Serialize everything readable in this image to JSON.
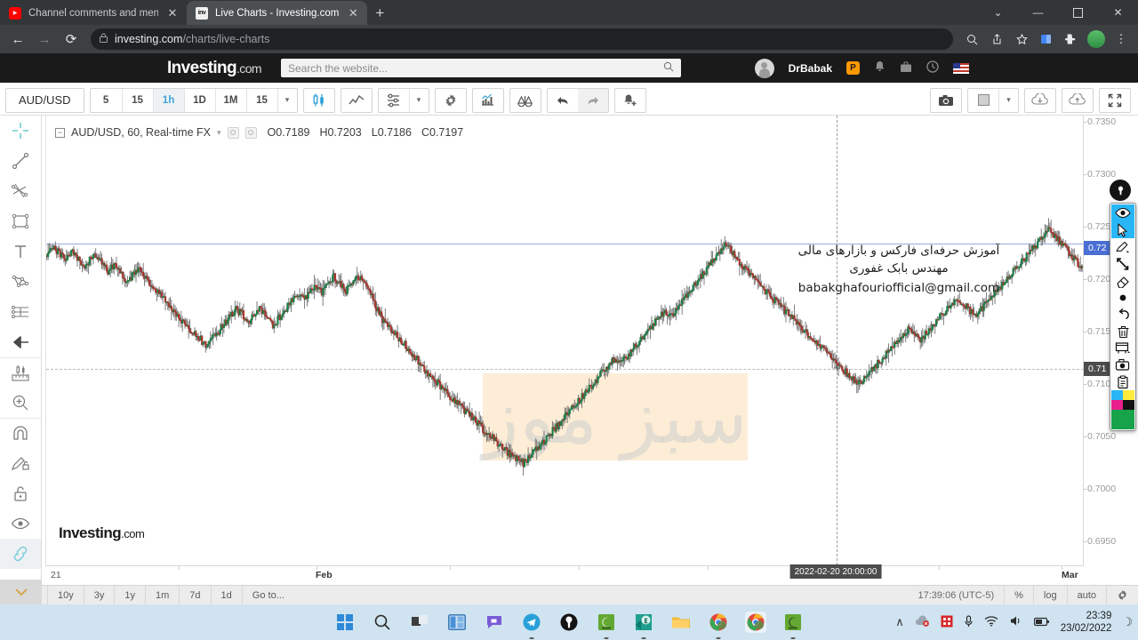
{
  "browser": {
    "tabs": [
      {
        "title": "Channel comments and mention",
        "favicon": "youtube-icon",
        "active": false
      },
      {
        "title": "Live Charts - Investing.com",
        "favicon": "investing-icon",
        "active": true
      }
    ],
    "new_tab_label": "+",
    "window_controls": {
      "chevron": "⌄",
      "minimize": "—",
      "maximize": "❐",
      "close": "✕"
    },
    "nav": {
      "back": "←",
      "forward": "→",
      "reload": "⟳"
    },
    "omnibox": {
      "lock": "🔒",
      "url_domain": "investing.com",
      "url_path": "/charts/live-charts"
    },
    "omni_icons": [
      "zoom-icon",
      "share-icon",
      "bookmark-star-icon",
      "split-screen-icon",
      "extensions-icon",
      "profile-avatar",
      "menu-kebab-icon"
    ]
  },
  "site_header": {
    "logo_main": "Investing",
    "logo_suffix": ".com",
    "search_placeholder": "Search the website...",
    "search_value": "",
    "user_name": "DrBabak",
    "pro_badge": "P",
    "icons": [
      "bell-icon",
      "portfolio-icon",
      "clock-icon",
      "flag-us-icon"
    ]
  },
  "chart_toolbar": {
    "symbol": "AUD/USD",
    "timeframes": [
      {
        "label": "5",
        "active": false
      },
      {
        "label": "15",
        "active": false
      },
      {
        "label": "1h",
        "active": true
      },
      {
        "label": "1D",
        "active": false
      },
      {
        "label": "1M",
        "active": false
      },
      {
        "label": "15",
        "active": false
      }
    ],
    "dropdown_caret": "▾",
    "buttons": [
      {
        "name": "candlestick-chart-type-icon",
        "selected": true
      },
      {
        "name": "line-chart-type-icon",
        "selected": false
      },
      {
        "name": "indicators-icon",
        "selected": false
      },
      {
        "name": "indicators-caret-icon",
        "selected": false
      },
      {
        "name": "settings-gear-icon",
        "selected": false
      },
      {
        "name": "compare-icon",
        "selected": false
      },
      {
        "name": "balance-scale-icon",
        "selected": false
      },
      {
        "name": "undo-icon",
        "selected": false
      },
      {
        "name": "redo-icon",
        "selected": false
      },
      {
        "name": "alert-bell-icon",
        "selected": false
      }
    ],
    "right_buttons": [
      {
        "name": "camera-snapshot-icon"
      },
      {
        "name": "layout-swatch-icon"
      },
      {
        "name": "layout-caret-icon"
      },
      {
        "name": "cloud-download-icon"
      },
      {
        "name": "cloud-upload-icon"
      },
      {
        "name": "fullscreen-icon"
      }
    ]
  },
  "left_tools": [
    {
      "name": "crosshair-tool"
    },
    {
      "name": "trend-line-tool"
    },
    {
      "name": "fib-tools"
    },
    {
      "name": "rectangle-tool"
    },
    {
      "name": "text-tool"
    },
    {
      "name": "pattern-tool"
    },
    {
      "name": "pitchfork-tool"
    },
    {
      "name": "arrow-tool"
    },
    {
      "name": "measure-tool"
    },
    {
      "name": "zoom-in-tool"
    },
    {
      "name": "magnet-tool"
    },
    {
      "name": "drawing-lock-tool"
    },
    {
      "name": "lock-tool"
    },
    {
      "name": "hide-drawings-tool"
    },
    {
      "name": "link-tool",
      "active": true
    }
  ],
  "chart_info": {
    "collapse": "−",
    "symbol_line": "AUD/USD, 60, Real-time FX",
    "caret": "▾",
    "open": "O0.7189",
    "high": "H0.7203",
    "low": "L0.7186",
    "close": "C0.7197"
  },
  "watermark": {
    "fa_line1": "آموزش حرفه‌ای فارکس و بازارهای مالی",
    "fa_line2": "مهندس بابک غفوری",
    "email": "babakghafouriofficial@gmail.com",
    "big_text": "سبز موز",
    "investing_main": "Investing",
    "investing_suffix": ".com"
  },
  "chart_data": {
    "type": "candlestick",
    "title": "AUD/USD, 60, Real-time FX",
    "symbol": "AUD/USD",
    "interval": "60",
    "source": "Real-time FX",
    "xlabel": "",
    "ylabel": "",
    "grid": true,
    "legend": "none",
    "ylim": [
      0.693,
      0.737
    ],
    "y_ticks": [
      "0.7350",
      "0.7300",
      "0.7250",
      "0.7200",
      "0.7150",
      "0.7100",
      "0.7050",
      "0.7000",
      "0.6950"
    ],
    "y_tick_values": [
      0.735,
      0.73,
      0.725,
      0.72,
      0.715,
      0.71,
      0.705,
      0.7,
      0.695
    ],
    "x_ticks": [
      "21",
      "Feb",
      "Mar"
    ],
    "price_labels": [
      {
        "value": "0.72",
        "kind": "current-bid",
        "color": "#4a6fd4",
        "y_value": 0.7219
      },
      {
        "value": "0.71",
        "kind": "crosshair",
        "color": "#4c4c4c",
        "y_value": 0.7142
      }
    ],
    "crosshair": {
      "x_label": "2022-02-20 20:00:00",
      "y_label": "0.71"
    },
    "colors": {
      "up": "#1a8046",
      "down": "#a8352d",
      "level_line": "#9aa8e0"
    },
    "ohlc_readout": {
      "open": 0.7189,
      "high": 0.7203,
      "low": 0.7186,
      "close": 0.7197
    },
    "series": [
      {
        "name": "AUD/USD 1h candles",
        "note": "close-price path sampled across the visible window (~0-1168px plot width)",
        "closes": [
          0.7233,
          0.724,
          0.7236,
          0.7228,
          0.7237,
          0.7231,
          0.7222,
          0.7228,
          0.7234,
          0.7225,
          0.7218,
          0.7224,
          0.7216,
          0.7209,
          0.7213,
          0.722,
          0.7214,
          0.7206,
          0.7198,
          0.7191,
          0.7185,
          0.7178,
          0.717,
          0.7163,
          0.7157,
          0.7152,
          0.7146,
          0.715,
          0.7158,
          0.7166,
          0.7173,
          0.718,
          0.7176,
          0.7169,
          0.7174,
          0.7181,
          0.7172,
          0.7165,
          0.7172,
          0.718,
          0.7188,
          0.7195,
          0.7189,
          0.7196,
          0.7203,
          0.7198,
          0.7206,
          0.7212,
          0.7205,
          0.7199,
          0.7206,
          0.7213,
          0.7208,
          0.7196,
          0.7182,
          0.717,
          0.7162,
          0.7156,
          0.715,
          0.7143,
          0.7136,
          0.7128,
          0.7121,
          0.7115,
          0.7108,
          0.7102,
          0.7096,
          0.709,
          0.7084,
          0.7078,
          0.7072,
          0.7066,
          0.706,
          0.7055,
          0.7049,
          0.7043,
          0.7038,
          0.7034,
          0.703,
          0.7036,
          0.7042,
          0.7049,
          0.7056,
          0.7063,
          0.707,
          0.7077,
          0.7084,
          0.7091,
          0.7098,
          0.7105,
          0.7112,
          0.7119,
          0.7126,
          0.7133,
          0.7128,
          0.7135,
          0.7142,
          0.715,
          0.7157,
          0.7164,
          0.7171,
          0.7178,
          0.7172,
          0.718,
          0.7188,
          0.7196,
          0.7204,
          0.7212,
          0.722,
          0.7228,
          0.7236,
          0.7244,
          0.7238,
          0.723,
          0.7222,
          0.7215,
          0.7208,
          0.7202,
          0.7196,
          0.719,
          0.7184,
          0.7178,
          0.7172,
          0.7166,
          0.716,
          0.7154,
          0.7148,
          0.7142,
          0.7136,
          0.713,
          0.7124,
          0.7118,
          0.7113,
          0.7108,
          0.7114,
          0.712,
          0.7127,
          0.7134,
          0.7141,
          0.7148,
          0.7155,
          0.7162,
          0.7156,
          0.715,
          0.7157,
          0.7164,
          0.7171,
          0.7178,
          0.7185,
          0.7192,
          0.7186,
          0.718,
          0.7174,
          0.7181,
          0.7188,
          0.7195,
          0.7202,
          0.7209,
          0.7216,
          0.7223,
          0.723,
          0.7237,
          0.7244,
          0.7251,
          0.7258,
          0.7252,
          0.7245,
          0.7238,
          0.7231,
          0.7224,
          0.7219
        ]
      }
    ]
  },
  "time_axis": {
    "labels": [
      {
        "text": "21",
        "x": 6,
        "bold": false
      },
      {
        "text": "Feb",
        "x": 304,
        "bold": true
      },
      {
        "text": "Mar",
        "x": 1143,
        "bold": true
      }
    ],
    "crosshair_badge": "2022-02-20 20:00:00"
  },
  "chart_footer": {
    "ranges": [
      "10y",
      "3y",
      "1y",
      "1m",
      "7d",
      "1d"
    ],
    "goto_label": "Go to...",
    "time": "17:39:06 (UTC-5)",
    "scale_percent": "%",
    "scale_log": "log",
    "scale_auto": "auto",
    "settings_icon": "gear-icon"
  },
  "annotation_toolbar": {
    "pen_orb": "pen-orb-icon",
    "items": [
      {
        "name": "eye-visibility-icon",
        "selected": true
      },
      {
        "name": "cursor-select-icon",
        "selected": true
      },
      {
        "name": "pen-highlighter-icon",
        "selected": false
      },
      {
        "name": "arrow-draw-icon",
        "selected": false
      },
      {
        "name": "eraser-icon",
        "selected": false
      },
      {
        "name": "dot-size-icon",
        "selected": false
      },
      {
        "name": "undo-arrow-icon",
        "selected": false
      },
      {
        "name": "trash-delete-icon",
        "selected": false
      },
      {
        "name": "whiteboard-icon",
        "selected": false
      },
      {
        "name": "screenshot-camera-icon",
        "selected": false
      },
      {
        "name": "clipboard-icon",
        "selected": false
      }
    ],
    "swatches": [
      "#29b6f6",
      "#ffeb3b",
      "#e91e8c",
      "#111111",
      "#16a34a"
    ]
  },
  "taskbar": {
    "items": [
      {
        "name": "start-windows-icon"
      },
      {
        "name": "search-icon"
      },
      {
        "name": "task-view-icon"
      },
      {
        "name": "widgets-icon"
      },
      {
        "name": "chat-teams-icon"
      },
      {
        "name": "telegram-icon"
      },
      {
        "name": "pen-app-icon"
      },
      {
        "name": "camtasia-icon"
      },
      {
        "name": "excel-icon"
      },
      {
        "name": "file-explorer-icon"
      },
      {
        "name": "chrome-icon"
      },
      {
        "name": "chrome-active-icon"
      },
      {
        "name": "camtasia-recorder-icon"
      }
    ],
    "tray": {
      "chevron": "∧",
      "icons": [
        "cloud-sync-icon",
        "red-badge-icon",
        "microphone-icon",
        "wifi-icon",
        "volume-icon",
        "battery-icon"
      ],
      "time": "23:39",
      "date": "23/02/2022",
      "notification": "☽"
    }
  }
}
